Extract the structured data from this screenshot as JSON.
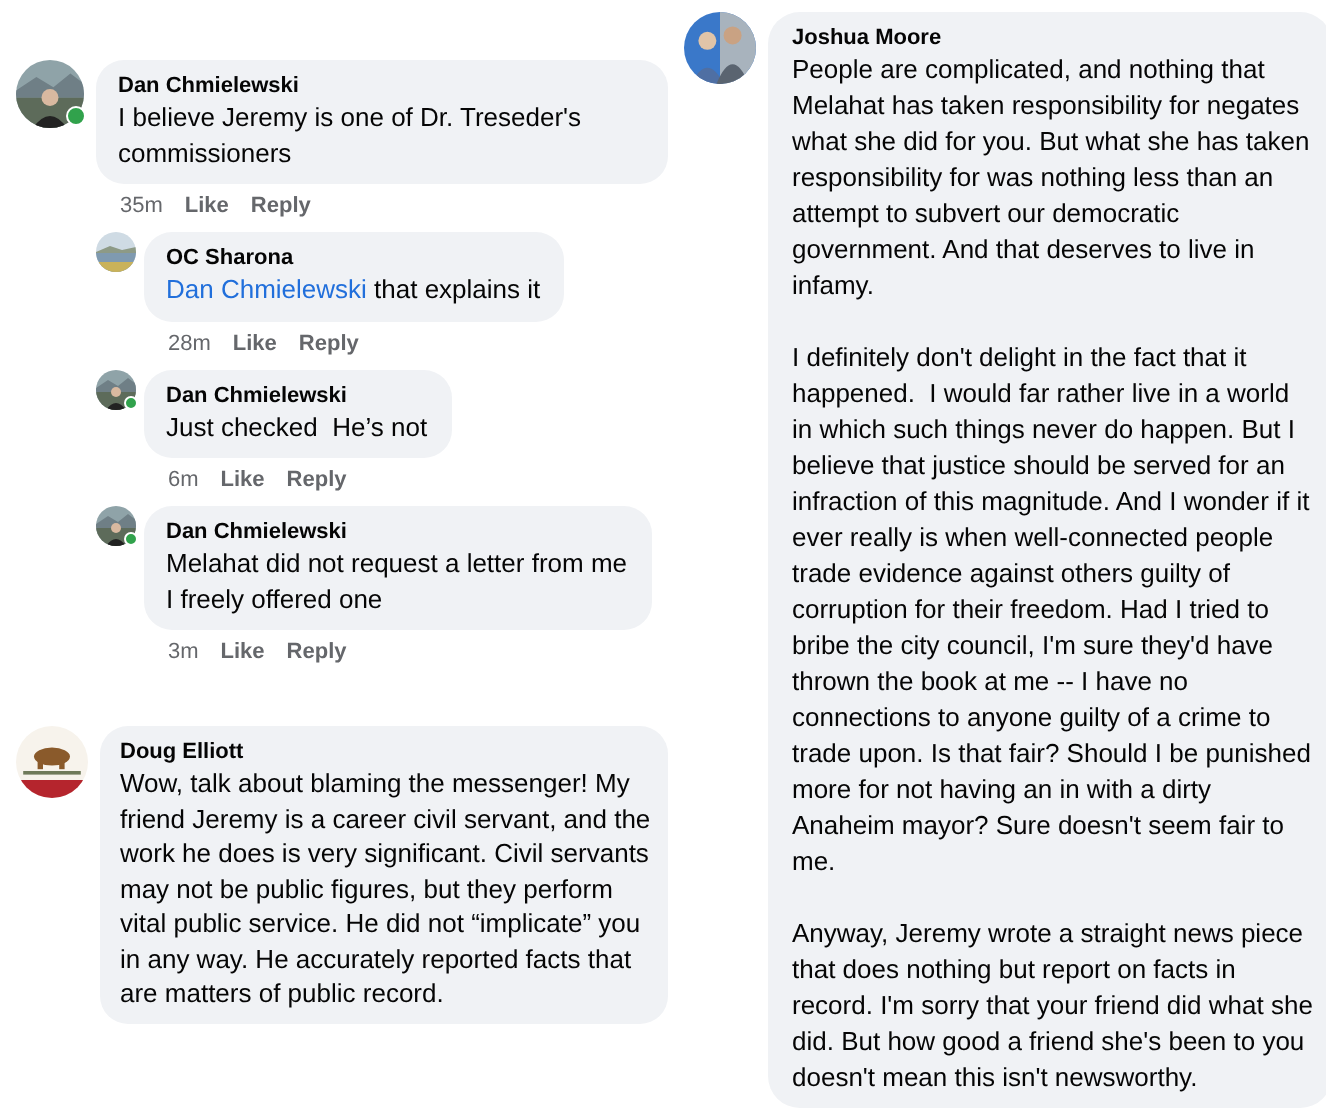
{
  "left_comments": [
    {
      "author": "Dan Chmielewski",
      "online": true,
      "paragraphs": [
        "I believe Jeremy is one of Dr. Treseder's commissioners"
      ],
      "meta": {
        "time": "35m",
        "actions": [
          "Like",
          "Reply"
        ]
      },
      "replies": [
        {
          "author": "OC Sharona",
          "online": false,
          "mention": "Dan Chmielewski",
          "paragraphs": [
            "that explains it"
          ],
          "meta": {
            "time": "28m",
            "actions": [
              "Like",
              "Reply"
            ]
          }
        },
        {
          "author": "Dan Chmielewski",
          "online": true,
          "paragraphs": [
            "Just checked  He’s not"
          ],
          "meta": {
            "time": "6m",
            "actions": [
              "Like",
              "Reply"
            ]
          }
        },
        {
          "author": "Dan Chmielewski",
          "online": true,
          "paragraphs": [
            "Melahat did not request a letter from me\nI freely offered one"
          ],
          "meta": {
            "time": "3m",
            "actions": [
              "Like",
              "Reply"
            ]
          }
        }
      ]
    },
    {
      "author": "Doug Elliott",
      "online": false,
      "paragraphs": [
        "Wow, talk about blaming the messenger! My friend Jeremy is a career civil servant, and the work he does is very significant. Civil servants may not be public figures, but they perform vital public service. He did not “implicate” you in any way. He accurately reported facts that are matters of public record."
      ]
    }
  ],
  "right_comment": {
    "author": "Joshua Moore",
    "online": false,
    "paragraphs": [
      "People are complicated, and nothing that Melahat has taken responsibility for negates what she did for you. But what she has taken responsibility for was nothing less than an attempt to subvert our democratic government. And that deserves to live in infamy.",
      "I definitely don't delight in the fact that it happened.  I would far rather live in a world in which such things never do happen. But I believe that justice should be served for an infraction of this magnitude. And I wonder if it ever really is when well-connected people trade evidence against others guilty of corruption for their freedom. Had I tried to bribe the city council, I'm sure they'd have thrown the book at me -- I have no connections to anyone guilty of a crime to trade upon. Is that fair? Should I be punished more for not having an in with a dirty Anaheim mayor? Sure doesn't seem fair to me.",
      "Anyway, Jeremy wrote a straight news piece that does nothing but report on facts in record. I'm sorry that your friend did what she did. But how good a friend she's been to you doesn't mean this isn't newsworthy."
    ]
  }
}
